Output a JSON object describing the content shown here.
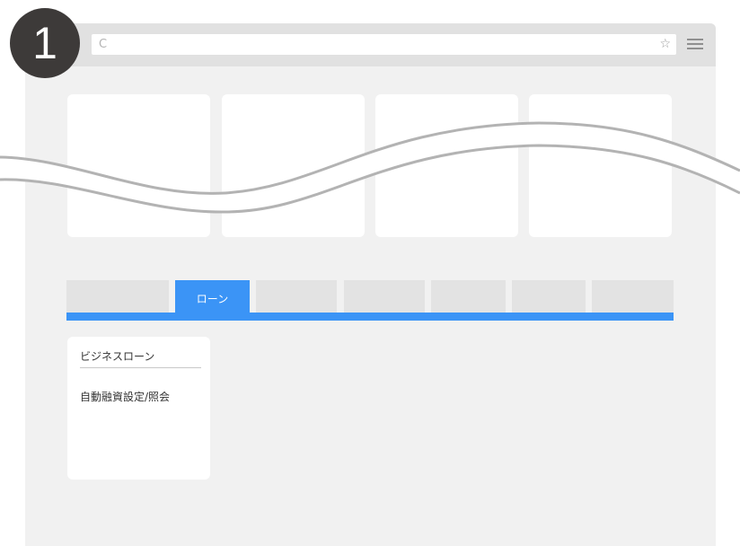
{
  "step": {
    "number": "1"
  },
  "browser": {
    "reload_glyph": "C",
    "star_glyph": "☆"
  },
  "tabs": [
    {
      "label": ""
    },
    {
      "label": "ローン",
      "active": true
    },
    {
      "label": ""
    },
    {
      "label": ""
    },
    {
      "label": ""
    },
    {
      "label": ""
    },
    {
      "label": ""
    }
  ],
  "menu_card": {
    "title": "ビジネスローン",
    "items": [
      {
        "label": "自動融資設定/照会"
      }
    ]
  },
  "colors": {
    "accent": "#3b94f6",
    "badge": "#3d3a39",
    "tab_inactive": "#e3e3e3",
    "content_bg": "#f1f1f1"
  }
}
